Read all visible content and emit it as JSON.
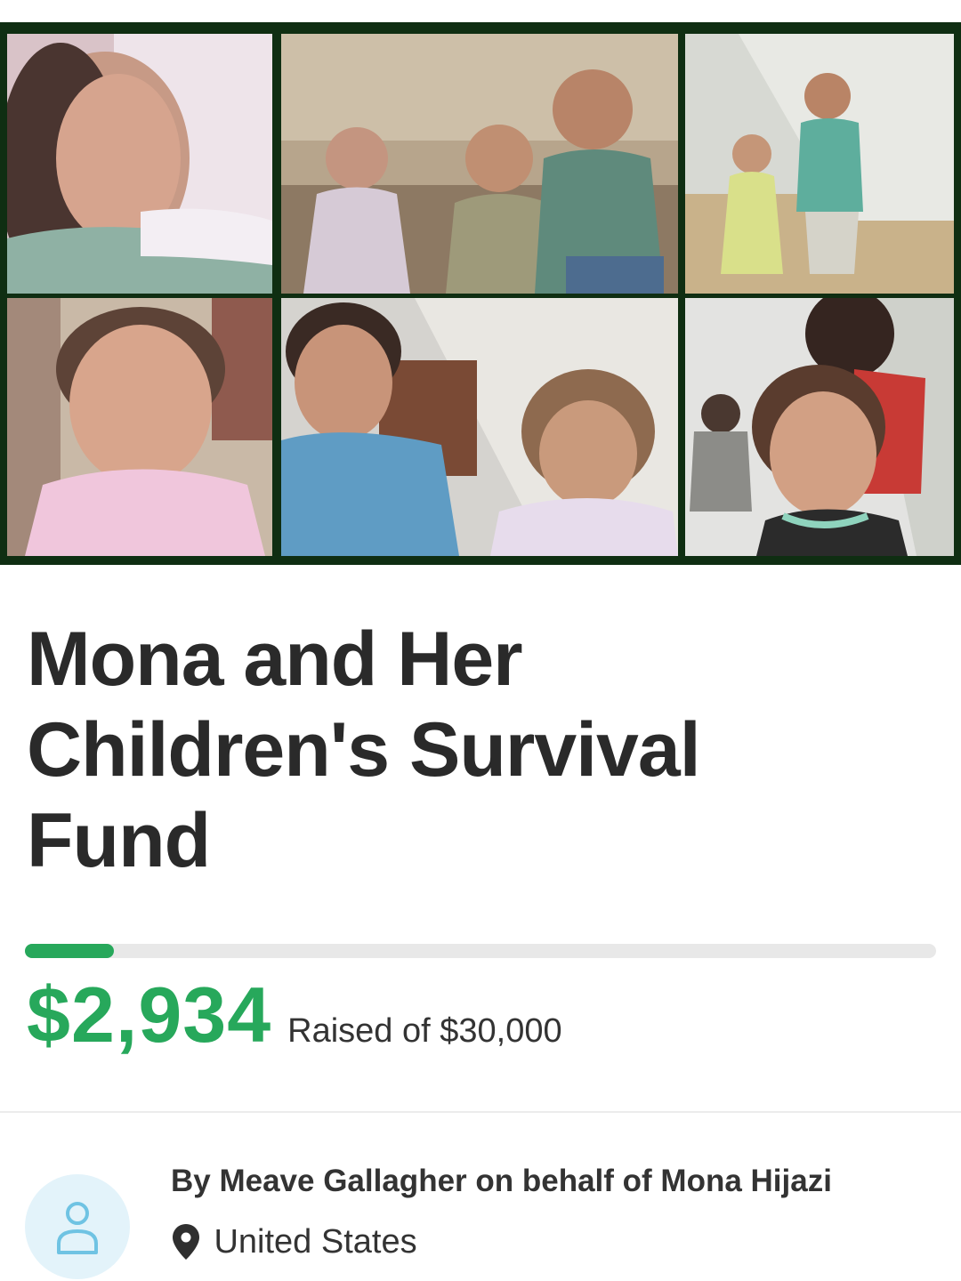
{
  "campaign": {
    "title": "Mona and Her Children's Survival Fund",
    "title_lines": [
      "Mona and Her",
      "Children's Survival",
      "Fund"
    ]
  },
  "hero": {
    "tiles": [
      {
        "name": "photo-girl-lying"
      },
      {
        "name": "photo-three-children-sitting"
      },
      {
        "name": "photo-children-at-tent"
      },
      {
        "name": "photo-girl-crying"
      },
      {
        "name": "photo-boy-and-girl"
      },
      {
        "name": "photo-girl-pigtails"
      }
    ]
  },
  "fundraising": {
    "raised_amount": "$2,934",
    "raised_label": "Raised of $30,000",
    "goal": 30000,
    "raised": 2934,
    "progress_fraction": 0.098,
    "accent_color": "#27a85b"
  },
  "organizer": {
    "byline": "By Meave Gallagher on behalf of Mona Hijazi",
    "location": "United States",
    "avatar_icon": "user-icon",
    "location_icon": "map-pin-icon"
  }
}
